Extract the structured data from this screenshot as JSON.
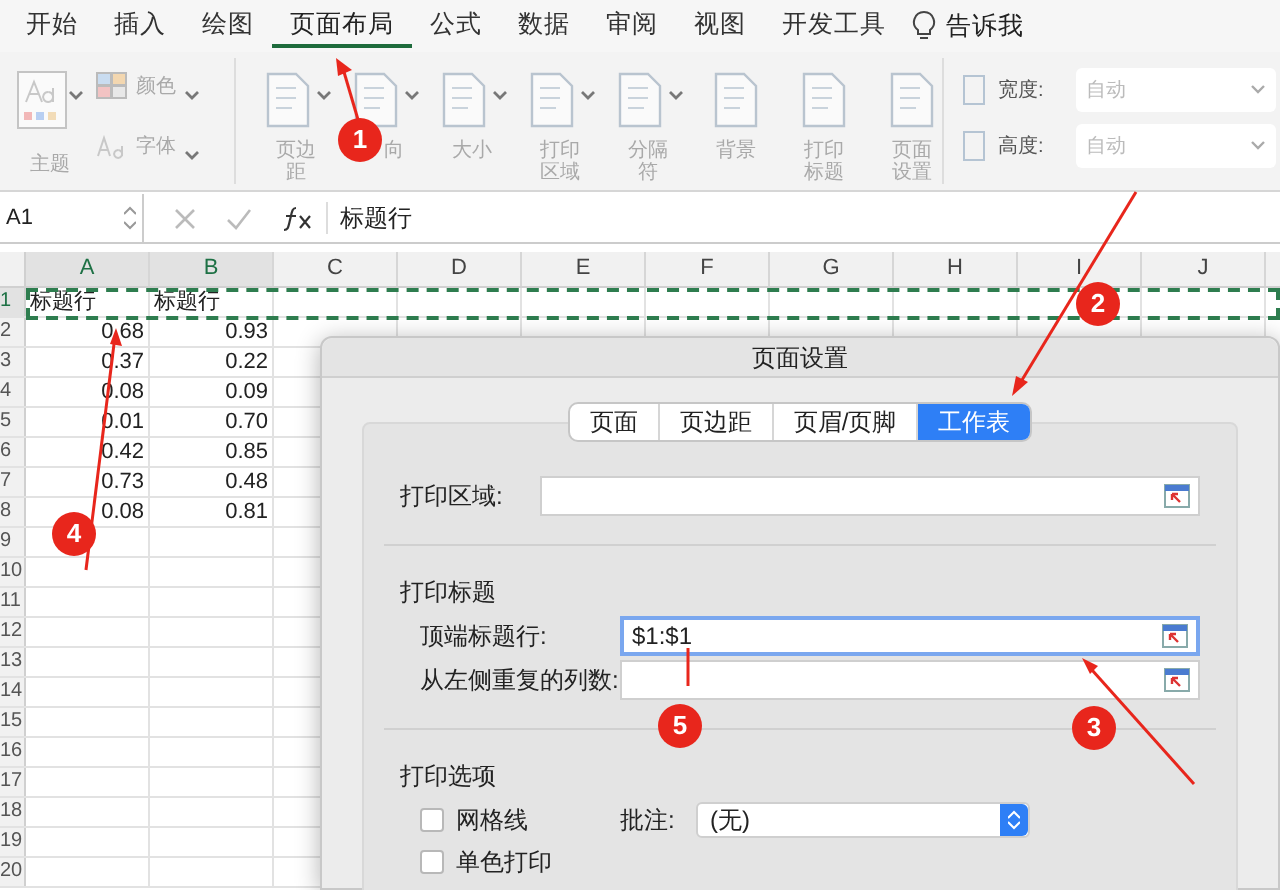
{
  "menu_tabs": [
    {
      "label": "开始",
      "selected": false
    },
    {
      "label": "插入",
      "selected": false
    },
    {
      "label": "绘图",
      "selected": false
    },
    {
      "label": "页面布局",
      "selected": true
    },
    {
      "label": "公式",
      "selected": false
    },
    {
      "label": "数据",
      "selected": false
    },
    {
      "label": "审阅",
      "selected": false
    },
    {
      "label": "视图",
      "selected": false
    },
    {
      "label": "开发工具",
      "selected": false
    }
  ],
  "tell_me": "告诉我",
  "ribbon": {
    "theme_label": "主题",
    "theme_options": [
      {
        "label": "颜色",
        "kind": "colors"
      },
      {
        "label": "字体",
        "kind": "fonts"
      }
    ],
    "page_buttons": [
      {
        "label": "页边距",
        "dropdown": true
      },
      {
        "label": "向",
        "dropdown": true
      },
      {
        "label": "大小",
        "dropdown": true
      },
      {
        "label": "打印区域",
        "dropdown": true
      },
      {
        "label": "分隔符",
        "dropdown": true
      },
      {
        "label": "背景",
        "dropdown": false
      },
      {
        "label": "打印标题",
        "dropdown": false
      },
      {
        "label": "页面设置",
        "dropdown": false
      }
    ],
    "scale": [
      {
        "label": "宽度:",
        "value": "自动",
        "disabled": true
      },
      {
        "label": "高度:",
        "value": "自动",
        "disabled": true
      }
    ]
  },
  "formula_bar": {
    "cell_ref": "A1",
    "content": "标题行"
  },
  "sheet": {
    "columns": [
      {
        "label": "A",
        "selected": true
      },
      {
        "label": "B",
        "selected": true
      },
      {
        "label": "C",
        "selected": false
      },
      {
        "label": "D",
        "selected": false
      },
      {
        "label": "E",
        "selected": false
      },
      {
        "label": "F",
        "selected": false
      },
      {
        "label": "G",
        "selected": false
      },
      {
        "label": "H",
        "selected": false
      },
      {
        "label": "I",
        "selected": false
      },
      {
        "label": "J",
        "selected": false
      }
    ],
    "rows": [
      {
        "number": "1",
        "selected": true,
        "cells": [
          "标题行",
          "标题行"
        ]
      },
      {
        "number": "2",
        "selected": false,
        "cells": [
          "0.68",
          "0.93"
        ]
      },
      {
        "number": "3",
        "selected": false,
        "cells": [
          "0.37",
          "0.22"
        ]
      },
      {
        "number": "4",
        "selected": false,
        "cells": [
          "0.08",
          "0.09"
        ]
      },
      {
        "number": "5",
        "selected": false,
        "cells": [
          "0.01",
          "0.70"
        ]
      },
      {
        "number": "6",
        "selected": false,
        "cells": [
          "0.42",
          "0.85"
        ]
      },
      {
        "number": "7",
        "selected": false,
        "cells": [
          "0.73",
          "0.48"
        ]
      },
      {
        "number": "8",
        "selected": false,
        "cells": [
          "0.08",
          "0.81"
        ]
      },
      {
        "number": "9",
        "selected": false
      },
      {
        "number": "10",
        "selected": false
      },
      {
        "number": "11",
        "selected": false
      },
      {
        "number": "12",
        "selected": false
      },
      {
        "number": "13",
        "selected": false
      },
      {
        "number": "14",
        "selected": false
      },
      {
        "number": "15",
        "selected": false
      },
      {
        "number": "16",
        "selected": false
      },
      {
        "number": "17",
        "selected": false
      },
      {
        "number": "18",
        "selected": false
      },
      {
        "number": "19",
        "selected": false
      },
      {
        "number": "20",
        "selected": false
      }
    ]
  },
  "dialog": {
    "title": "页面设置",
    "tabs": [
      {
        "label": "页面",
        "selected": false
      },
      {
        "label": "页边距",
        "selected": false
      },
      {
        "label": "页眉/页脚",
        "selected": false
      },
      {
        "label": "工作表",
        "selected": true
      }
    ],
    "print_area": {
      "label": "打印区域:"
    },
    "print_titles": {
      "heading": "打印标题",
      "fields": [
        {
          "label": "顶端标题行:",
          "value": "$1:$1",
          "focused": true
        },
        {
          "label": "从左侧重复的列数:",
          "focused": false
        }
      ]
    },
    "print_options": {
      "heading": "打印选项",
      "checkboxes": [
        {
          "label": "网格线",
          "checked": false
        },
        {
          "label": "单色打印",
          "checked": false
        }
      ],
      "comments": {
        "label": "批注:",
        "value": "(无)"
      }
    }
  },
  "annotations": [
    {
      "label": "1"
    },
    {
      "label": "2"
    },
    {
      "label": "3"
    },
    {
      "label": "4"
    },
    {
      "label": "5"
    }
  ]
}
